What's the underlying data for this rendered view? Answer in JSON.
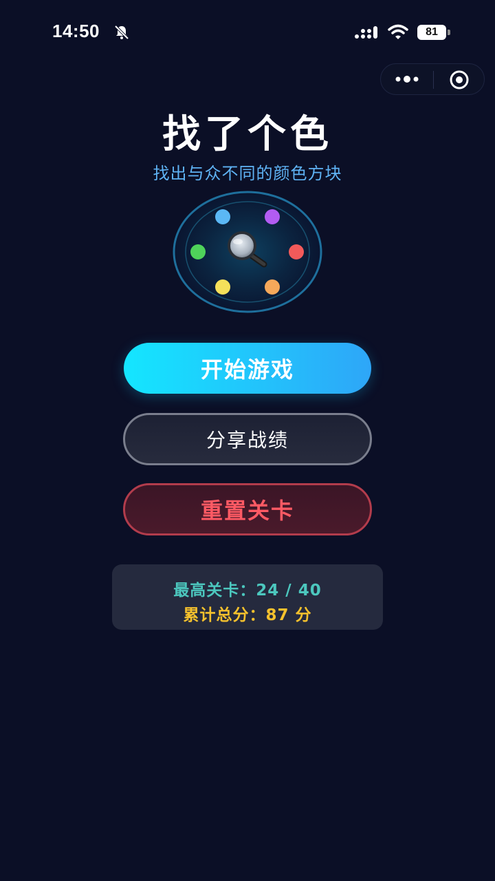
{
  "status_bar": {
    "time": "14:50",
    "battery": "81",
    "icons": [
      "bell-muted-icon",
      "signal-icon",
      "wifi-icon",
      "battery-icon"
    ]
  },
  "capsule": {
    "icons": [
      "more-dots-icon",
      "target-icon"
    ]
  },
  "header": {
    "title": "找了个色",
    "subtitle": "找出与众不同的颜色方块"
  },
  "logo": {
    "icon": "magnifier-icon",
    "dot_colors": [
      "#5bb8f5",
      "#b25cf2",
      "#f25a5a",
      "#f5a85a",
      "#f5e05a",
      "#4fd35a"
    ]
  },
  "buttons": {
    "start": "开始游戏",
    "share": "分享战绩",
    "reset": "重置关卡"
  },
  "stats": {
    "high_level_label": "最高关卡：",
    "high_level_value": "24 / 40",
    "total_score_label": "累计总分：",
    "total_score_value": "87 分"
  },
  "colors": {
    "background": "#0b0f26",
    "accent": "#14e6ff",
    "subtitle": "#5fb3f5",
    "danger": "#ff5a64",
    "stat_teal": "#4cc7be",
    "stat_gold": "#f5c12d"
  }
}
